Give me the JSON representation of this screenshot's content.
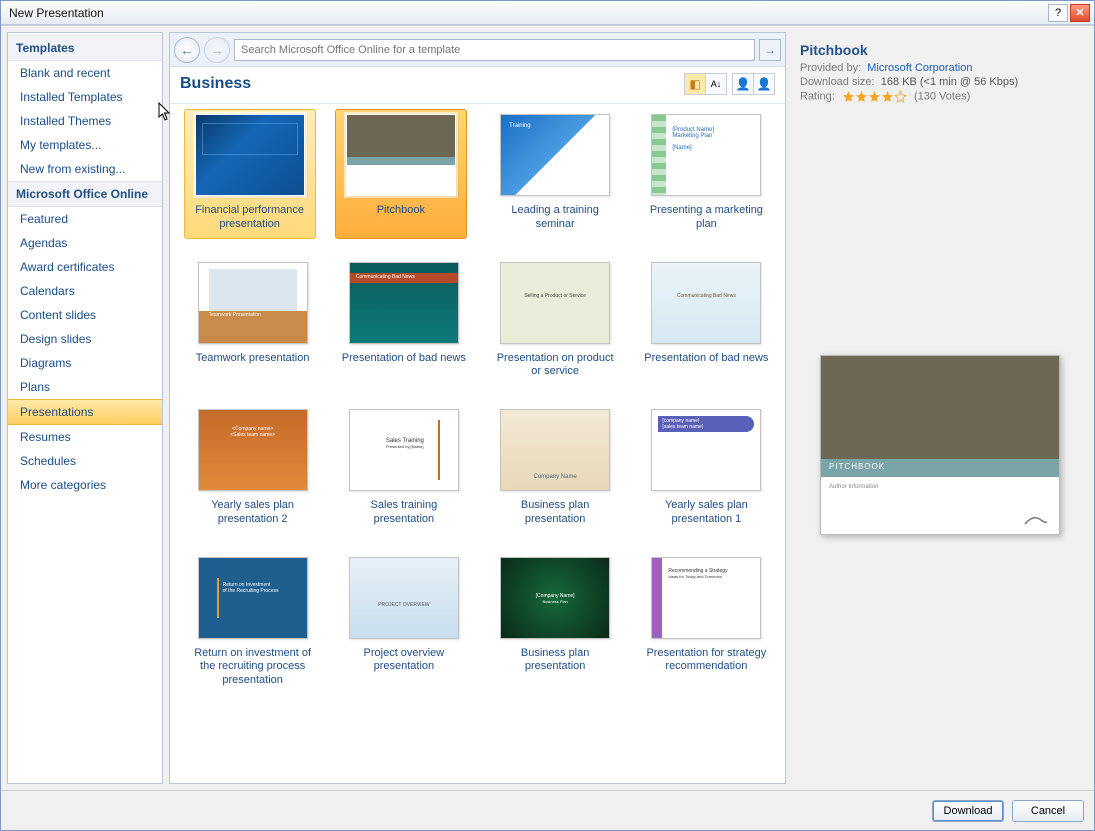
{
  "window": {
    "title": "New Presentation"
  },
  "sidebar": {
    "header1": "Templates",
    "items1": [
      "Blank and recent",
      "Installed Templates",
      "Installed Themes",
      "My templates...",
      "New from existing..."
    ],
    "header2": "Microsoft Office Online",
    "items2": [
      "Featured",
      "Agendas",
      "Award certificates",
      "Calendars",
      "Content slides",
      "Design slides",
      "Diagrams",
      "Plans",
      "Presentations",
      "Resumes",
      "Schedules",
      "More categories"
    ],
    "selected": "Presentations"
  },
  "search": {
    "placeholder": "Search Microsoft Office Online for a template"
  },
  "category": {
    "title": "Business"
  },
  "templates": [
    {
      "label": "Financial performance presentation",
      "thumb": "blue",
      "state": "highlight"
    },
    {
      "label": "Pitchbook",
      "thumb": "pitch",
      "state": "selected"
    },
    {
      "label": "Leading a training seminar",
      "thumb": "train"
    },
    {
      "label": "Presenting a marketing plan",
      "thumb": "plan"
    },
    {
      "label": "Teamwork presentation",
      "thumb": "team"
    },
    {
      "label": "Presentation of bad news",
      "thumb": "news1"
    },
    {
      "label": "Presentation on product or service",
      "thumb": "prod"
    },
    {
      "label": "Presentation of bad news",
      "thumb": "news2"
    },
    {
      "label": "Yearly sales plan presentation 2",
      "thumb": "yearly2"
    },
    {
      "label": "Sales training presentation",
      "thumb": "sales"
    },
    {
      "label": "Business plan presentation",
      "thumb": "bplan"
    },
    {
      "label": "Yearly sales plan presentation 1",
      "thumb": "yearly1"
    },
    {
      "label": "Return on investment of the recruiting process presentation",
      "thumb": "roi"
    },
    {
      "label": "Project overview presentation",
      "thumb": "proj"
    },
    {
      "label": "Business plan presentation",
      "thumb": "bplan2"
    },
    {
      "label": "Presentation for strategy recommendation",
      "thumb": "strat"
    }
  ],
  "preview": {
    "title": "Pitchbook",
    "provided_label": "Provided by:",
    "provided_value": "Microsoft Corporation",
    "size_label": "Download size:",
    "size_value": "168 KB (<1 min @ 56 Kbps)",
    "rating_label": "Rating:",
    "votes": "(130 Votes)",
    "thumb_title": "PITCHBOOK",
    "thumb_sub": "Author Information"
  },
  "buttons": {
    "download": "Download",
    "cancel": "Cancel"
  }
}
